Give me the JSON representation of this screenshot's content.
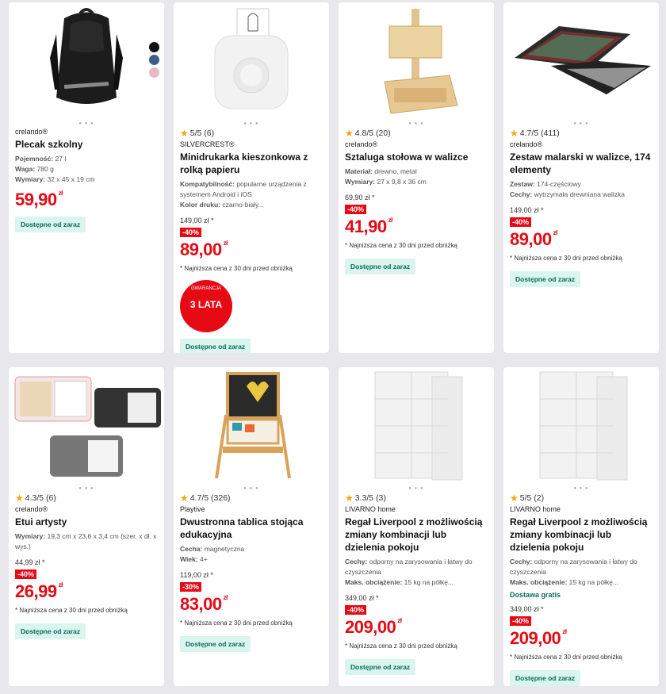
{
  "cards": [
    {
      "brand": "crelando®",
      "title": "Plecak szkolny",
      "attrs": [
        {
          "label": "Pojemność:",
          "value": "27 l"
        },
        {
          "label": "Waga:",
          "value": "780 g"
        },
        {
          "label": "Wymiary:",
          "value": "32 x 45 x 19 cm"
        }
      ],
      "price": "59,90",
      "currency": "zł",
      "availability": "Dostępne od zaraz",
      "swatches": [
        "#111111",
        "#3b5d88",
        "#e8b9c3"
      ]
    },
    {
      "rating": "5/5 (6)",
      "brand": "SILVERCREST®",
      "title": "Minidrukarka kieszonkowa z rolką papieru",
      "attrs": [
        {
          "label": "Kompatybilność:",
          "value": "popularne urządzenia z systemem Android i iOS"
        },
        {
          "label": "Kolor druku:",
          "value": "czarno-biały..."
        }
      ],
      "old_price": "149,00 zł *",
      "discount": "-40%",
      "price": "89,00",
      "currency": "zł",
      "note": "* Najniższa cena z 30 dni przed obniżką",
      "badge": "3 LATA",
      "badge_word": "GWARANCJA",
      "availability": "Dostępne od zaraz"
    },
    {
      "rating": "4.8/5 (20)",
      "brand": "crelando®",
      "title": "Sztaluga stołowa w walizce",
      "attrs": [
        {
          "label": "Materiał:",
          "value": "drewno, metal"
        },
        {
          "label": "Wymiary:",
          "value": "27 x 9,8 x 36 cm"
        }
      ],
      "old_price": "69,90 zł *",
      "discount": "-40%",
      "price": "41,90",
      "currency": "zł",
      "note": "* Najniższa cena z 30 dni przed obniżką",
      "availability": "Dostępne od zaraz"
    },
    {
      "rating": "4.7/5 (411)",
      "brand": "crelando®",
      "title": "Zestaw malarski w walizce, 174 elementy",
      "attrs": [
        {
          "label": "Zestaw:",
          "value": "174-częściowy"
        },
        {
          "label": "Cechy:",
          "value": "wytrzymała drewniana walizka"
        }
      ],
      "old_price": "149,00 zł *",
      "discount": "-40%",
      "price": "89,00",
      "currency": "zł",
      "note": "* Najniższa cena z 30 dni przed obniżką",
      "availability": "Dostępne od zaraz"
    },
    {
      "rating": "4.3/5 (6)",
      "brand": "crelando®",
      "title": "Etui artysty",
      "attrs": [
        {
          "label": "Wymiary:",
          "value": "19,3 cm x 23,6 x 3,4 cm (szer. x dł. x wys.)"
        }
      ],
      "old_price": "44,99 zł *",
      "discount": "-40%",
      "price": "26,99",
      "currency": "zł",
      "note": "* Najniższa cena z 30 dni przed obniżką",
      "availability": "Dostępne od zaraz"
    },
    {
      "rating": "4.7/5 (326)",
      "brand": "Playtive",
      "title": "Dwustronna tablica stojąca edukacyjna",
      "attrs": [
        {
          "label": "Cecha:",
          "value": "magnetyczna"
        },
        {
          "label": "Wiek:",
          "value": "4+"
        }
      ],
      "old_price": "119,00 zł *",
      "discount": "-30%",
      "price": "83,00",
      "currency": "zł",
      "note": "* Najniższa cena z 30 dni przed obniżką",
      "availability": "Dostępne od zaraz"
    },
    {
      "rating": "3.3/5 (3)",
      "brand": "LIVARNO home",
      "title": "Regał Liverpool z możliwością zmiany kombinacji lub dzielenia pokoju",
      "attrs": [
        {
          "label": "Cechy:",
          "value": "odporny na zarysowania i łatwy do czyszczenia"
        },
        {
          "label": "Maks. obciążenie:",
          "value": "15 kg na półkę..."
        }
      ],
      "old_price": "349,00 zł *",
      "discount": "-40%",
      "price": "209,00",
      "currency": "zł",
      "note": "* Najniższa cena z 30 dni przed obniżką",
      "availability": "Dostępne od zaraz"
    },
    {
      "rating": "5/5 (2)",
      "brand": "LIVARNO home",
      "title": "Regał Liverpool z możliwością zmiany kombinacji lub dzielenia pokoju",
      "attrs": [
        {
          "label": "Cechy:",
          "value": "odporny na zarysowania i łatwy do czyszczenia"
        },
        {
          "label": "Maks. obciążenie:",
          "value": "15 kg na półkę..."
        }
      ],
      "shipping": "Dostawa gratis",
      "old_price": "349,00 zł *",
      "discount": "-40%",
      "price": "209,00",
      "currency": "zł",
      "note": "* Najniższa cena z 30 dni przed obniżką",
      "availability": "Dostępne od zaraz"
    }
  ]
}
